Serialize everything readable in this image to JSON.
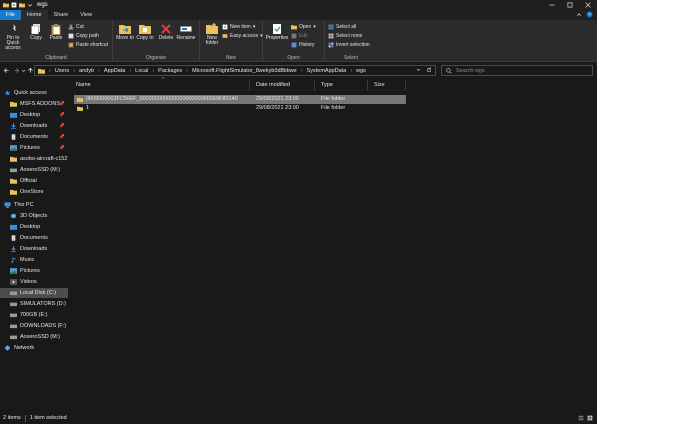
{
  "window": {
    "title": "wgs"
  },
  "tabs": [
    {
      "label": "File"
    },
    {
      "label": "Home"
    },
    {
      "label": "Share"
    },
    {
      "label": "View"
    }
  ],
  "ribbon": {
    "clipboard": {
      "label": "Clipboard",
      "pin": "Pin to Quick access",
      "copy": "Copy",
      "paste": "Paste",
      "cut": "Cut",
      "copy_path": "Copy path",
      "paste_shortcut": "Paste shortcut"
    },
    "organize": {
      "label": "Organize",
      "move_to": "Move to",
      "copy_to": "Copy to",
      "delete": "Delete",
      "rename": "Rename"
    },
    "new": {
      "label": "New",
      "new_folder": "New folder",
      "new_item": "New item",
      "easy_access": "Easy access"
    },
    "open": {
      "label": "Open",
      "properties": "Properties",
      "open": "Open",
      "edit": "Edit",
      "history": "History"
    },
    "select": {
      "label": "Select",
      "select_all": "Select all",
      "select_none": "Select none",
      "invert": "Invert selection"
    }
  },
  "address": {
    "crumbs": [
      "Users",
      "andyb",
      "AppData",
      "Local",
      "Packages",
      "Microsoft.FlightSimulator_8wekyb3d8bbwe",
      "SystemAppData",
      "wgs"
    ]
  },
  "search": {
    "placeholder": "Search wgs"
  },
  "nav": {
    "quick_access": "Quick access",
    "quick_items": [
      {
        "label": "MSFS ADDONS"
      },
      {
        "label": "Desktop"
      },
      {
        "label": "Downloads"
      },
      {
        "label": "Documents"
      },
      {
        "label": "Pictures"
      },
      {
        "label": "asobo-aircraft-c152"
      },
      {
        "label": "AoseroSSD (M:)"
      },
      {
        "label": "Official"
      },
      {
        "label": "OneStore"
      }
    ],
    "this_pc": "This PC",
    "pc_items": [
      {
        "label": "3D Objects"
      },
      {
        "label": "Desktop"
      },
      {
        "label": "Documents"
      },
      {
        "label": "Downloads"
      },
      {
        "label": "Music"
      },
      {
        "label": "Pictures"
      },
      {
        "label": "Videos"
      },
      {
        "label": "Local Disk (C:)"
      },
      {
        "label": "SIMULATORS (D:)"
      },
      {
        "label": "700GB (E:)"
      },
      {
        "label": "DOWNLOADS (F:)"
      },
      {
        "label": "AoseroSSD (M:)"
      }
    ],
    "network": "Network"
  },
  "columns": {
    "name": "Name",
    "date": "Date modified",
    "type": "Type",
    "size": "Size"
  },
  "files": [
    {
      "name": "0009000003FC566F_00000000000000000000000069F80140",
      "date": "29/08/2021 23:00",
      "type": "File folder",
      "size": ""
    },
    {
      "name": "1",
      "date": "29/08/2021 23:00",
      "type": "File folder",
      "size": ""
    }
  ],
  "status": {
    "items": "2 items",
    "selected": "1 item selected"
  },
  "colors": {
    "accent": "#1979ca",
    "background": "#191919",
    "ribbon": "#2b2b2b",
    "folder": "#e8c35a",
    "selection": "#777777"
  }
}
